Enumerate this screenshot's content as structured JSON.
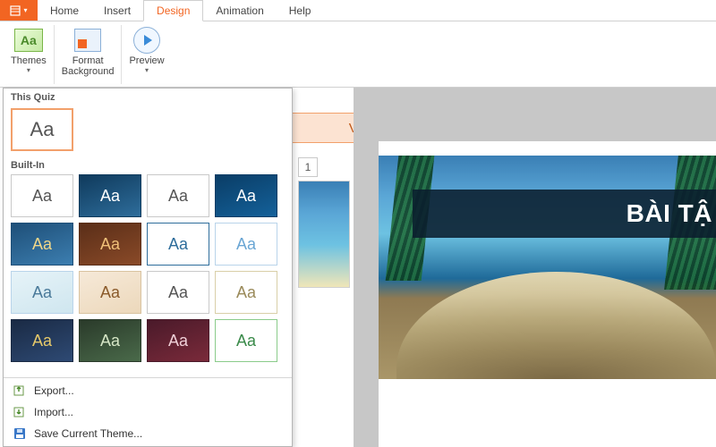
{
  "menubar": {
    "items": [
      "Home",
      "Insert",
      "Design",
      "Animation",
      "Help"
    ],
    "active_index": 2
  },
  "ribbon": {
    "themes": {
      "label": "Themes",
      "icon_text": "Aa"
    },
    "format_bg": {
      "label": "Format\nBackground"
    },
    "preview": {
      "label": "Preview"
    }
  },
  "themes_dropdown": {
    "section_this_quiz": "This Quiz",
    "this_quiz_thumb_text": "Aa",
    "section_built_in": "Built-In",
    "themes": [
      {
        "text": "Aa",
        "bg": "#ffffff",
        "fg": "#555555",
        "border": "#c9c9c9"
      },
      {
        "text": "Aa",
        "bg": "linear-gradient(160deg,#0f3a5c 0,#2e6d9b 100%)",
        "fg": "#ffffff",
        "border": "#0f3a5c"
      },
      {
        "text": "Aa",
        "bg": "#ffffff",
        "fg": "#555555",
        "border": "#c9c9c9"
      },
      {
        "text": "Aa",
        "bg": "linear-gradient(160deg,#0a3d66 0,#14619a 100%)",
        "fg": "#ffffff",
        "border": "#0a3d66"
      },
      {
        "text": "Aa",
        "bg": "linear-gradient(160deg,#1e4f78 0,#3c7eb0 100%)",
        "fg": "#f0d78a",
        "border": "#1e4f78"
      },
      {
        "text": "Aa",
        "bg": "linear-gradient(160deg,#5a2e18 0,#8a4a28 100%)",
        "fg": "#f0c078",
        "border": "#5a2e18"
      },
      {
        "text": "Aa",
        "bg": "#ffffff",
        "fg": "#2e6d9b",
        "border": "#2e6d9b"
      },
      {
        "text": "Aa",
        "bg": "#ffffff",
        "fg": "#6aa6d4",
        "border": "#b9d4ea"
      },
      {
        "text": "Aa",
        "bg": "linear-gradient(160deg,#e6f3f8 0,#cfe6ef 100%)",
        "fg": "#4a7a9a",
        "border": "#b9d4ea"
      },
      {
        "text": "Aa",
        "bg": "linear-gradient(160deg,#f6e9d8 0,#ecd8bb 100%)",
        "fg": "#8a5a2a",
        "border": "#d9c3a0"
      },
      {
        "text": "Aa",
        "bg": "#ffffff",
        "fg": "#555555",
        "border": "#c9c9c9"
      },
      {
        "text": "Aa",
        "bg": "#ffffff",
        "fg": "#9a8a5a",
        "border": "#d9cfa8"
      },
      {
        "text": "Aa",
        "bg": "linear-gradient(160deg,#1a2a44 0,#2e4a74 100%)",
        "fg": "#e6c96a",
        "border": "#1a2a44"
      },
      {
        "text": "Aa",
        "bg": "linear-gradient(160deg,#2a3a2a 0,#4a6a4a 100%)",
        "fg": "#d6e6c6",
        "border": "#2a3a2a"
      },
      {
        "text": "Aa",
        "bg": "linear-gradient(160deg,#4a1a2a 0,#7a2a3a 100%)",
        "fg": "#f0d0d8",
        "border": "#4a1a2a"
      },
      {
        "text": "Aa",
        "bg": "#ffffff",
        "fg": "#3a8a4a",
        "border": "#8acb8a"
      }
    ],
    "actions": {
      "export": "Export...",
      "import": "Import...",
      "save": "Save Current Theme..."
    }
  },
  "editor": {
    "tab_label": "View",
    "slide_number": "1",
    "slide_title": "BÀI TẬ"
  }
}
